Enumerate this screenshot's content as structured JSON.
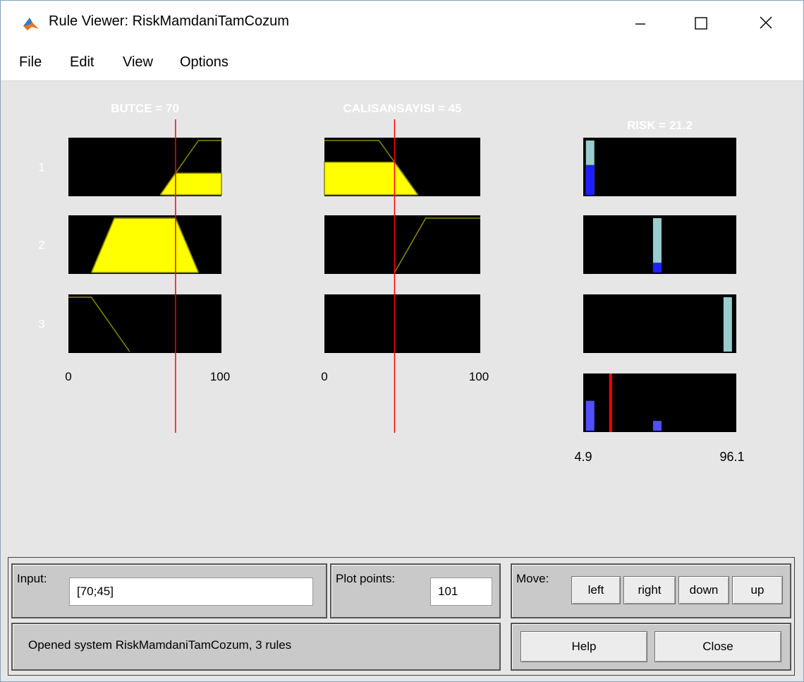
{
  "window": {
    "title": "Rule Viewer: RiskMamdaniTamCozum",
    "app_icon": "matlab-logo-icon"
  },
  "menubar": [
    "File",
    "Edit",
    "View",
    "Options"
  ],
  "plots": {
    "inputs": [
      {
        "name": "BUTCE",
        "value": 70,
        "label": "BUTCE = 70",
        "range": [
          0,
          100
        ],
        "range_min_label": "0",
        "range_max_label": "100"
      },
      {
        "name": "CALISANSAYISI",
        "value": 45,
        "label": "CALISANSAYISI = 45",
        "range": [
          0,
          100
        ],
        "range_min_label": "0",
        "range_max_label": "100"
      }
    ],
    "output": {
      "name": "RISK",
      "value": 21.2,
      "label": "RISK = 21.2",
      "range": [
        4.9,
        96.1
      ],
      "range_min_label": "4.9",
      "range_max_label": "96.1"
    },
    "rule_numbers": [
      "1",
      "2",
      "3"
    ],
    "colors": {
      "mf_fill": "#ffff00",
      "mf_outline": "#8a8a00",
      "cursor": "#ff0000",
      "output_full": "#99cccc",
      "output_implied": "#1e1eff",
      "aggregate": "#5050ff",
      "axes_bg": "#000000",
      "title_text": "#ffffff"
    }
  },
  "controls": {
    "input_label": "Input:",
    "input_value": "[70;45]",
    "plot_points_label": "Plot points:",
    "plot_points_value": "101",
    "move_label": "Move:",
    "move_buttons": [
      "left",
      "right",
      "down",
      "up"
    ],
    "status": "Opened system RiskMamdaniTamCozum, 3 rules",
    "help_label": "Help",
    "close_label": "Close"
  }
}
